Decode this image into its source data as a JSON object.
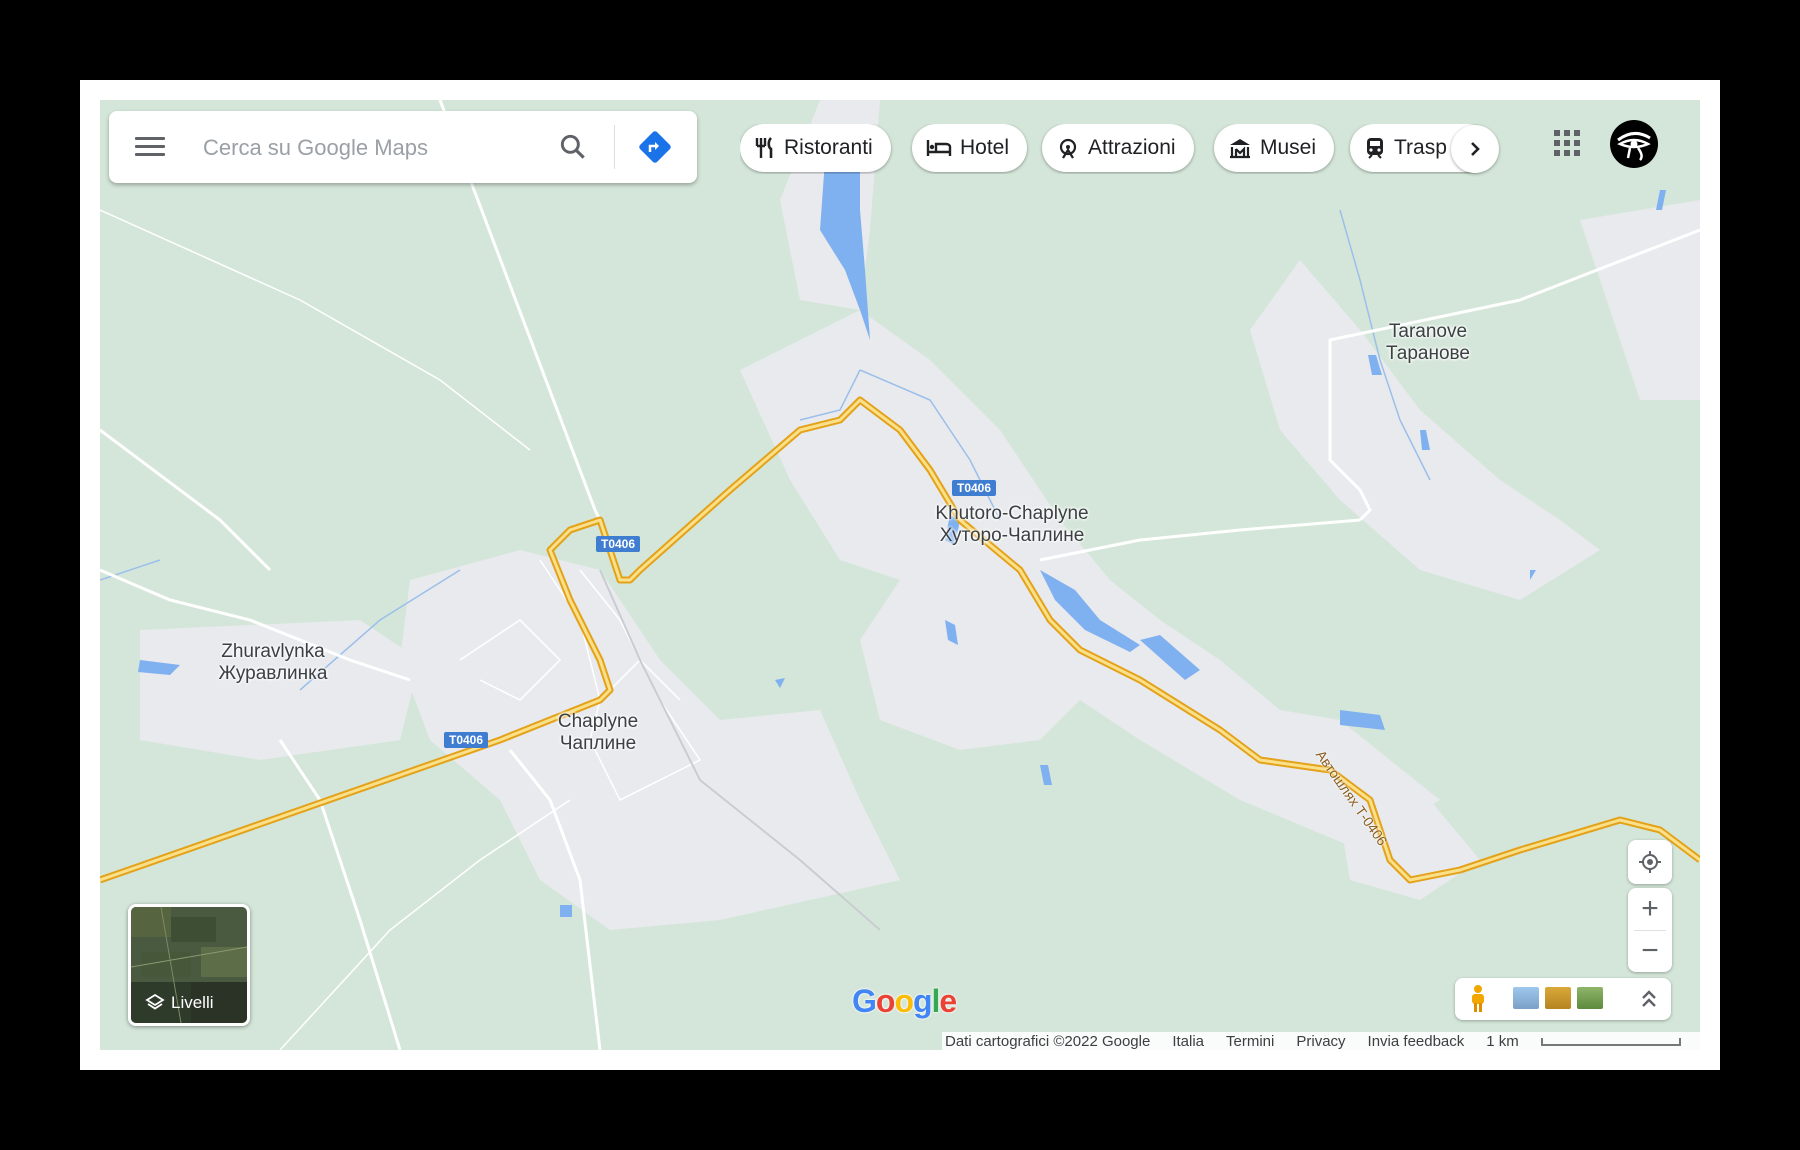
{
  "search": {
    "placeholder": "Cerca su Google Maps"
  },
  "chips": [
    {
      "label": "Ristoranti",
      "icon": "restaurant-icon"
    },
    {
      "label": "Hotel",
      "icon": "hotel-icon"
    },
    {
      "label": "Attrazioni",
      "icon": "attractions-icon"
    },
    {
      "label": "Musei",
      "icon": "museum-icon"
    },
    {
      "label": "Trasp",
      "icon": "transit-icon"
    }
  ],
  "places": {
    "taranove_lat": "Taranove",
    "taranove_cyr": "Таранове",
    "khutoro_lat": "Khutoro-Chaplyne",
    "khutoro_cyr": "Хуторо-Чаплине",
    "zhuravlynka_lat": "Zhuravlynka",
    "zhuravlynka_cyr": "Журавлинка",
    "chaplyne_lat": "Chaplyne",
    "chaplyne_cyr": "Чаплине"
  },
  "roads": {
    "shield": "T0406",
    "highway_name": "Автошлях Т-0406"
  },
  "layers_label": "Livelli",
  "controls": {
    "zoom_in": "+",
    "zoom_out": "−"
  },
  "logo": "Google",
  "footer": {
    "data": "Dati cartografici ©2022 Google",
    "country": "Italia",
    "terms": "Termini",
    "privacy": "Privacy",
    "feedback": "Invia feedback",
    "scale": "1 km"
  },
  "colors": {
    "map_bg": "#d9e8de",
    "urban": "#e8eaed",
    "water": "#7fb0f0",
    "highway": "#f6c846",
    "shield": "#3f7dd1",
    "accent_blue": "#1a73e8"
  }
}
